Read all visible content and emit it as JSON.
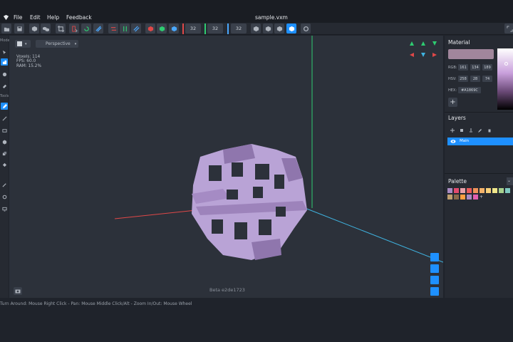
{
  "app": {
    "window_title": "sample.vxm",
    "menu": [
      "File",
      "Edit",
      "Help",
      "Feedback"
    ]
  },
  "toolbar": {
    "brush_size_1": "32",
    "brush_size_2": "32",
    "brush_size_3": "32"
  },
  "left_tools": {
    "section_mode": "Mode",
    "section_tools": "Tools"
  },
  "viewport": {
    "projection": "Perspective",
    "stats": {
      "voxels": "Voxels: 114",
      "fps": "FPS: 60.0",
      "ram": "RAM: 15.2%"
    },
    "build_label": "Beta e2de1723",
    "model_color": "#b9a3d6"
  },
  "material": {
    "title": "Material",
    "color": "#a1869c",
    "rgb_label": "RGB:",
    "rgb": [
      "161",
      "134",
      "189"
    ],
    "hsv_label": "HSV:",
    "hsv": [
      "258",
      "28",
      "74"
    ],
    "hex_label": "HEX:",
    "hex": "#A1869C"
  },
  "layers": {
    "title": "Layers",
    "items": [
      {
        "name": "Main"
      }
    ]
  },
  "palette": {
    "title": "Palette",
    "colors": [
      "#a98bc2",
      "#e24a6e",
      "#e8a0a8",
      "#ea5b5b",
      "#f0935a",
      "#f4b36a",
      "#f7d07a",
      "#f0e68a",
      "#a8d08d",
      "#7fc8c0",
      "#c0a070",
      "#8a6a4a",
      "#ff9f40",
      "#a98bc2",
      "#e15fb0"
    ]
  },
  "status": {
    "hint": "Turn Around: Mouse Right Click - Pan: Mouse Middle Click/Alt - Zoom In/Out: Mouse Wheel"
  }
}
